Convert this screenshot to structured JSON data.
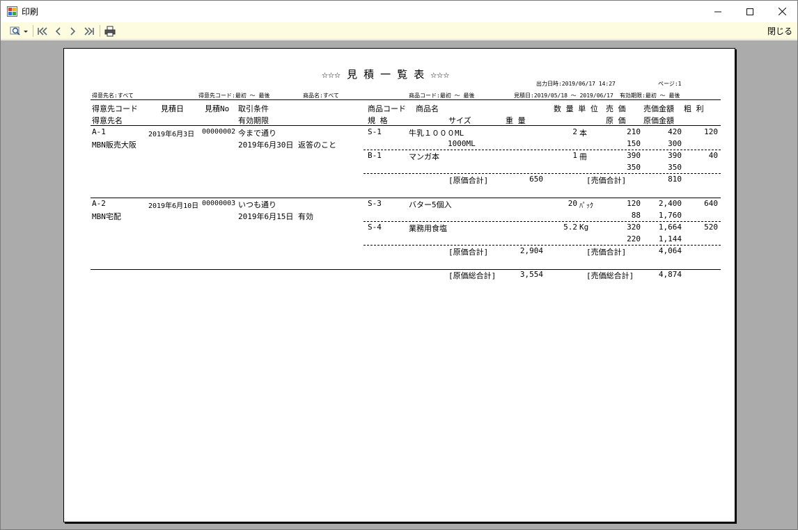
{
  "window": {
    "title": "印刷"
  },
  "toolbar": {
    "close_label": "閉じる"
  },
  "report": {
    "title": "☆☆☆ 見 積 一 覧 表 ☆☆☆",
    "output_datetime": "出力日時:2019/06/17 14:27",
    "page": "ページ:1",
    "filters": {
      "customer_name": "得意先名:すべて",
      "customer_code": "得意先コード:最初 ～ 最後",
      "product_name": "商品名:すべて",
      "product_code": "商品コード:最初 ～ 最後",
      "estimate_date": "見積日:2019/05/18 ～ 2019/06/17",
      "valid_until": "有効期限:最初 ～ 最後"
    },
    "headers": {
      "customer_code": "得意先コード",
      "estimate_date": "見積日",
      "estimate_no": "見積No",
      "terms": "取引条件",
      "product_code": "商品コード",
      "product_name": "商品名",
      "qty_unit": "数 量 単 位",
      "sale_price": "売 価",
      "sale_amount": "売価金額",
      "gross_profit": "粗 利",
      "customer_name": "得意先名",
      "valid_until": "有効期限",
      "spec": "規 格",
      "size": "サイズ",
      "weight": "重 量",
      "cost_price": "原 価",
      "cost_amount": "原価金額"
    },
    "estimates": [
      {
        "customer_code": "A-1",
        "customer_name": "MBN販売大阪",
        "date": "2019年6月3日",
        "no": "00000002",
        "terms": "今まで通り",
        "valid_until": "2019年6月30日",
        "note": "返答のこと",
        "items": [
          {
            "code": "S-1",
            "name": "牛乳１０００ML",
            "size": "1000ML",
            "qty": "2",
            "unit": "本",
            "sale_price": "210",
            "sale_amount": "420",
            "profit": "120",
            "cost_price": "150",
            "cost_amount": "300"
          },
          {
            "code": "B-1",
            "name": "マンガ本",
            "size": "",
            "qty": "1",
            "unit": "冊",
            "sale_price": "390",
            "sale_amount": "390",
            "profit": "40",
            "cost_price": "350",
            "cost_amount": "350"
          }
        ],
        "cost_total_label": "[原価合計]",
        "cost_total": "650",
        "sale_total_label": "[売価合計]",
        "sale_total": "810"
      },
      {
        "customer_code": "A-2",
        "customer_name": "MBN宅配",
        "date": "2019年6月10日",
        "no": "00000003",
        "terms": "いつも通り",
        "valid_until": "2019年6月15日",
        "note": "有効",
        "items": [
          {
            "code": "S-3",
            "name": "バター5個入",
            "size": "",
            "qty": "20",
            "unit": "ﾊﾟｯｸ",
            "sale_price": "120",
            "sale_amount": "2,400",
            "profit": "640",
            "cost_price": "88",
            "cost_amount": "1,760"
          },
          {
            "code": "S-4",
            "name": "業務用食塩",
            "size": "",
            "qty": "5.2",
            "unit": "Kg",
            "sale_price": "320",
            "sale_amount": "1,664",
            "profit": "520",
            "cost_price": "220",
            "cost_amount": "1,144"
          }
        ],
        "cost_total_label": "[原価合計]",
        "cost_total": "2,904",
        "sale_total_label": "[売価合計]",
        "sale_total": "4,064"
      }
    ],
    "grand": {
      "cost_label": "[原価総合計]",
      "cost_total": "3,554",
      "sale_label": "[売価総合計]",
      "sale_total": "4,874"
    }
  }
}
